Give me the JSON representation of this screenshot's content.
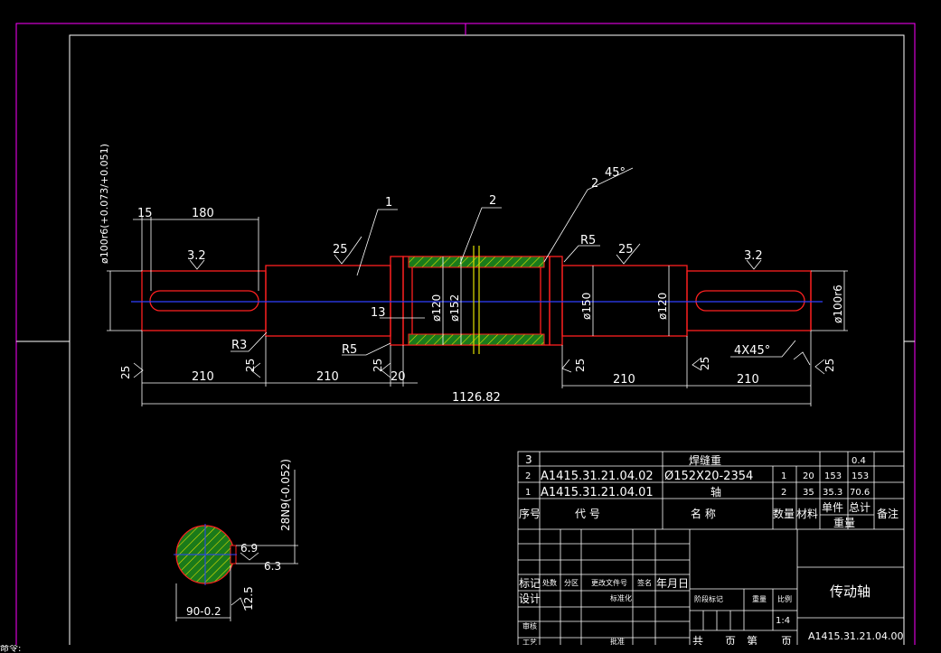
{
  "colors": {
    "background": "#000000",
    "outline": "#ff2020",
    "dimension": "#ffffff",
    "centerline": "#3040ff",
    "hatch": "#20a020",
    "hatch_line": "#e0e000",
    "sheet_frame": "#ff00ff"
  },
  "labels": {
    "part1": "1",
    "part2": "2",
    "part2b": "2",
    "chamfer_angle": "45°",
    "r5_top": "R5",
    "r5_bottom": "R5",
    "r3": "R3",
    "rough_25": "25",
    "rough_32": "3.2",
    "chamfer": "4X45°",
    "d100_left": "ø100r6(+0.073/+0.051)",
    "d100_right": "ø100r6",
    "d120_a": "ø120",
    "d152": "ø152",
    "d150": "ø150",
    "d120_b": "ø120",
    "dim_15": "15",
    "dim_180": "180",
    "dim_13": "13",
    "dim_20": "20",
    "dim_210_a": "210",
    "dim_210_b": "210",
    "dim_210_c": "210",
    "dim_210_d": "210",
    "dim_total": "1126.82",
    "key_width": "28N9(-0.052)",
    "sec_69": "6.9",
    "sec_63": "6.3",
    "sec_125": "12.5",
    "sec_90": "90-0.2",
    "cmd": "命令:"
  },
  "bom": {
    "rows": [
      {
        "no": "3",
        "code": "",
        "name": "焊缝重",
        "qty": "",
        "mat": "",
        "unit_w": "",
        "total_w": "0.4"
      },
      {
        "no": "2",
        "code": "A1415.31.21.04.02",
        "name": "Ø152X20-2354",
        "qty": "1",
        "mat": "20",
        "unit_w": "153",
        "total_w": "153"
      },
      {
        "no": "1",
        "code": "A1415.31.21.04.01",
        "name": "轴",
        "qty": "2",
        "mat": "35",
        "unit_w": "35.3",
        "total_w": "70.6"
      }
    ],
    "headers": {
      "no": "序号",
      "code": "代 号",
      "name": "名 称",
      "qty": "数量",
      "mat": "材料",
      "unit_w": "单件",
      "total_w": "总计",
      "weight": "重量",
      "remark": "备注"
    }
  },
  "title_block": {
    "mark": "标记",
    "count": "处数",
    "zone": "分区",
    "change_doc": "更改文件号",
    "sign": "签名",
    "date": "年月日",
    "design": "设计",
    "standard": "标准化",
    "review": "审核",
    "process": "工艺",
    "approve": "批准",
    "stage": "阶段标记",
    "weight": "重量",
    "scale": "比例",
    "scale_val": "1:4",
    "sheets_total": "共",
    "sheet_word": "页",
    "sheet_no": "第",
    "sheet_word2": "页",
    "part_name": "传动轴",
    "drawing_no": "A1415.31.21.04.00"
  }
}
